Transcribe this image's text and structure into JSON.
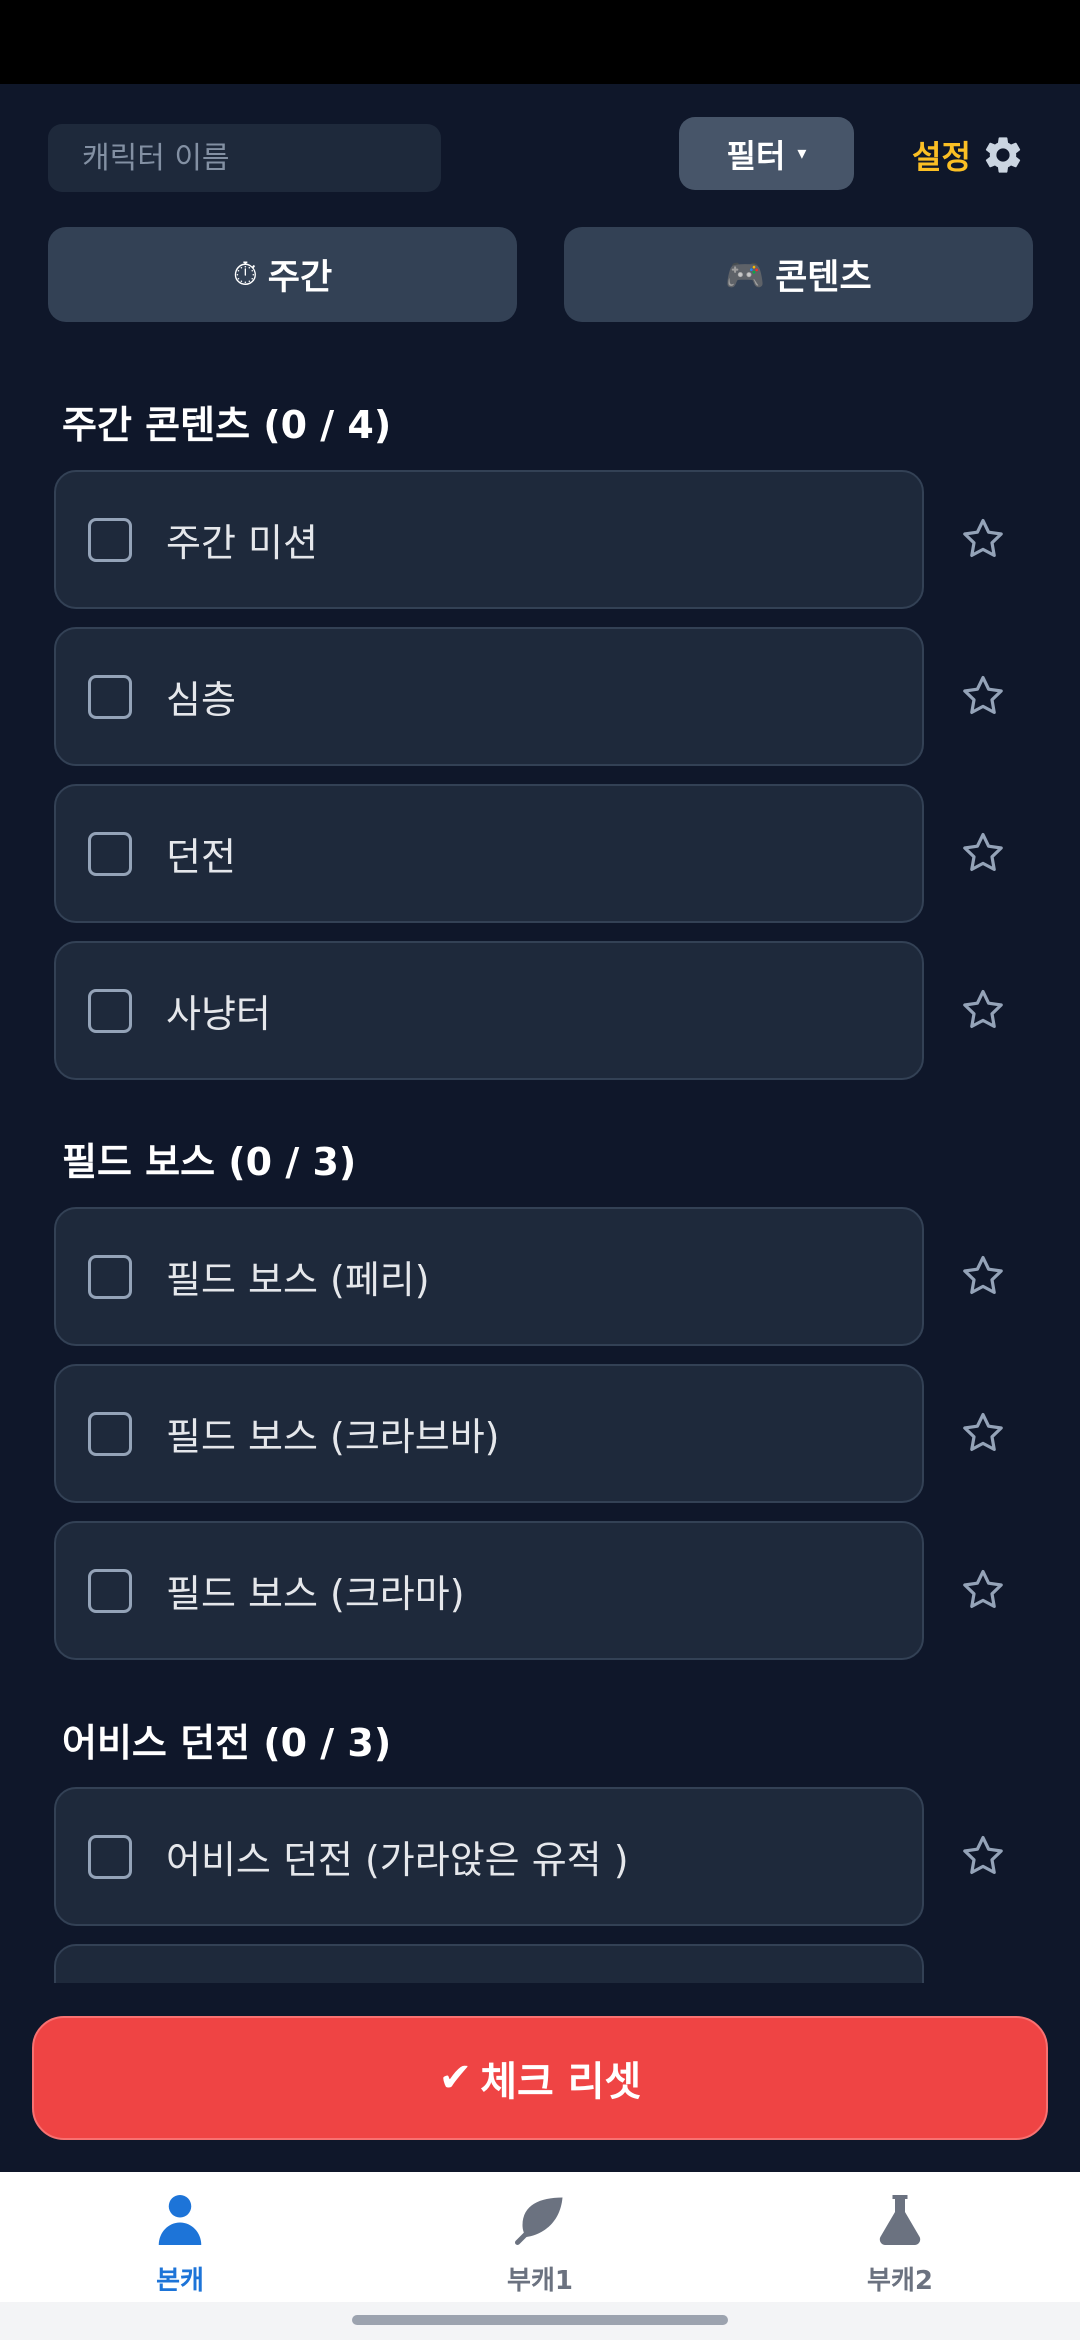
{
  "top_bar": {
    "search_placeholder": "캐릭터 이름",
    "filter_label": "필터",
    "filter_caret": "▾",
    "settings_label": "설정"
  },
  "tabs": [
    {
      "icon": "⏱",
      "label": "주간"
    },
    {
      "icon": "🎮",
      "label": "콘텐츠"
    }
  ],
  "sections": [
    {
      "title": "주간 콘텐츠 (0 / 4)",
      "items": [
        {
          "label": "주간 미션",
          "checked": false,
          "starred": false
        },
        {
          "label": "심층",
          "checked": false,
          "starred": false
        },
        {
          "label": "던전",
          "checked": false,
          "starred": false
        },
        {
          "label": "사냥터",
          "checked": false,
          "starred": false
        }
      ]
    },
    {
      "title": "필드 보스 (0 / 3)",
      "items": [
        {
          "label": "필드 보스 (페리)",
          "checked": false,
          "starred": false
        },
        {
          "label": "필드 보스 (크라브바)",
          "checked": false,
          "starred": false
        },
        {
          "label": "필드 보스 (크라마)",
          "checked": false,
          "starred": false
        }
      ]
    },
    {
      "title": "어비스 던전 (0 / 3)",
      "items": [
        {
          "label": "어비스 던전 (가라앉은 유적 )",
          "checked": false,
          "starred": false
        },
        {
          "label": "",
          "checked": false,
          "starred": false
        }
      ]
    }
  ],
  "reset_button": {
    "icon": "✔",
    "label": "체크 리셋"
  },
  "bottom_nav": [
    {
      "icon": "person-icon",
      "label": "본캐",
      "active": true
    },
    {
      "icon": "leaf-icon",
      "label": "부캐1",
      "active": false
    },
    {
      "icon": "flask-icon",
      "label": "부캐2",
      "active": false
    }
  ],
  "colors": {
    "background": "#0f172a",
    "card": "#1e293b",
    "tab": "#334155",
    "accent_settings": "#fbbf24",
    "reset": "#ef4444",
    "nav_active": "#1d74d8",
    "nav_inactive": "#6b7280"
  }
}
